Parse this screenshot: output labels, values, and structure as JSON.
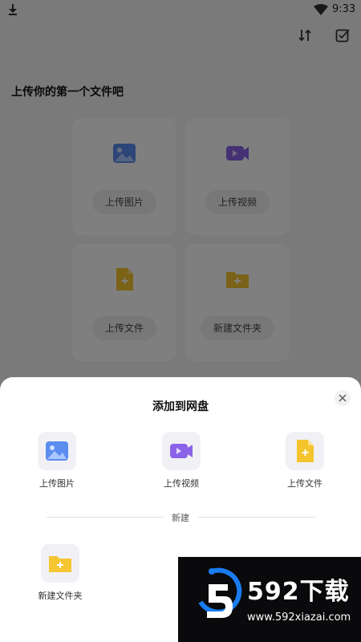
{
  "status_bar": {
    "time": "9:33"
  },
  "page": {
    "heading": "上传你的第一个文件吧",
    "cards": [
      {
        "label": "上传图片",
        "icon": "image-icon"
      },
      {
        "label": "上传视频",
        "icon": "video-icon"
      },
      {
        "label": "上传文件",
        "icon": "file-icon"
      },
      {
        "label": "新建文件夹",
        "icon": "folder-icon"
      }
    ]
  },
  "sheet": {
    "title": "添加到网盘",
    "options": [
      {
        "label": "上传图片",
        "icon": "image-icon"
      },
      {
        "label": "上传视频",
        "icon": "video-icon"
      },
      {
        "label": "上传文件",
        "icon": "file-icon"
      }
    ],
    "divider_label": "新建",
    "new_items": [
      {
        "label": "新建文件夹",
        "icon": "folder-icon"
      }
    ]
  },
  "watermark": {
    "brand": "592下载",
    "url": "www.592xiazai.com"
  },
  "colors": {
    "image_blue": "#5b8def",
    "video_purple": "#8a63e8",
    "file_yellow": "#f5c42c",
    "folder_yellow": "#f6c532",
    "watermark_blue": "#1a7cf0"
  }
}
